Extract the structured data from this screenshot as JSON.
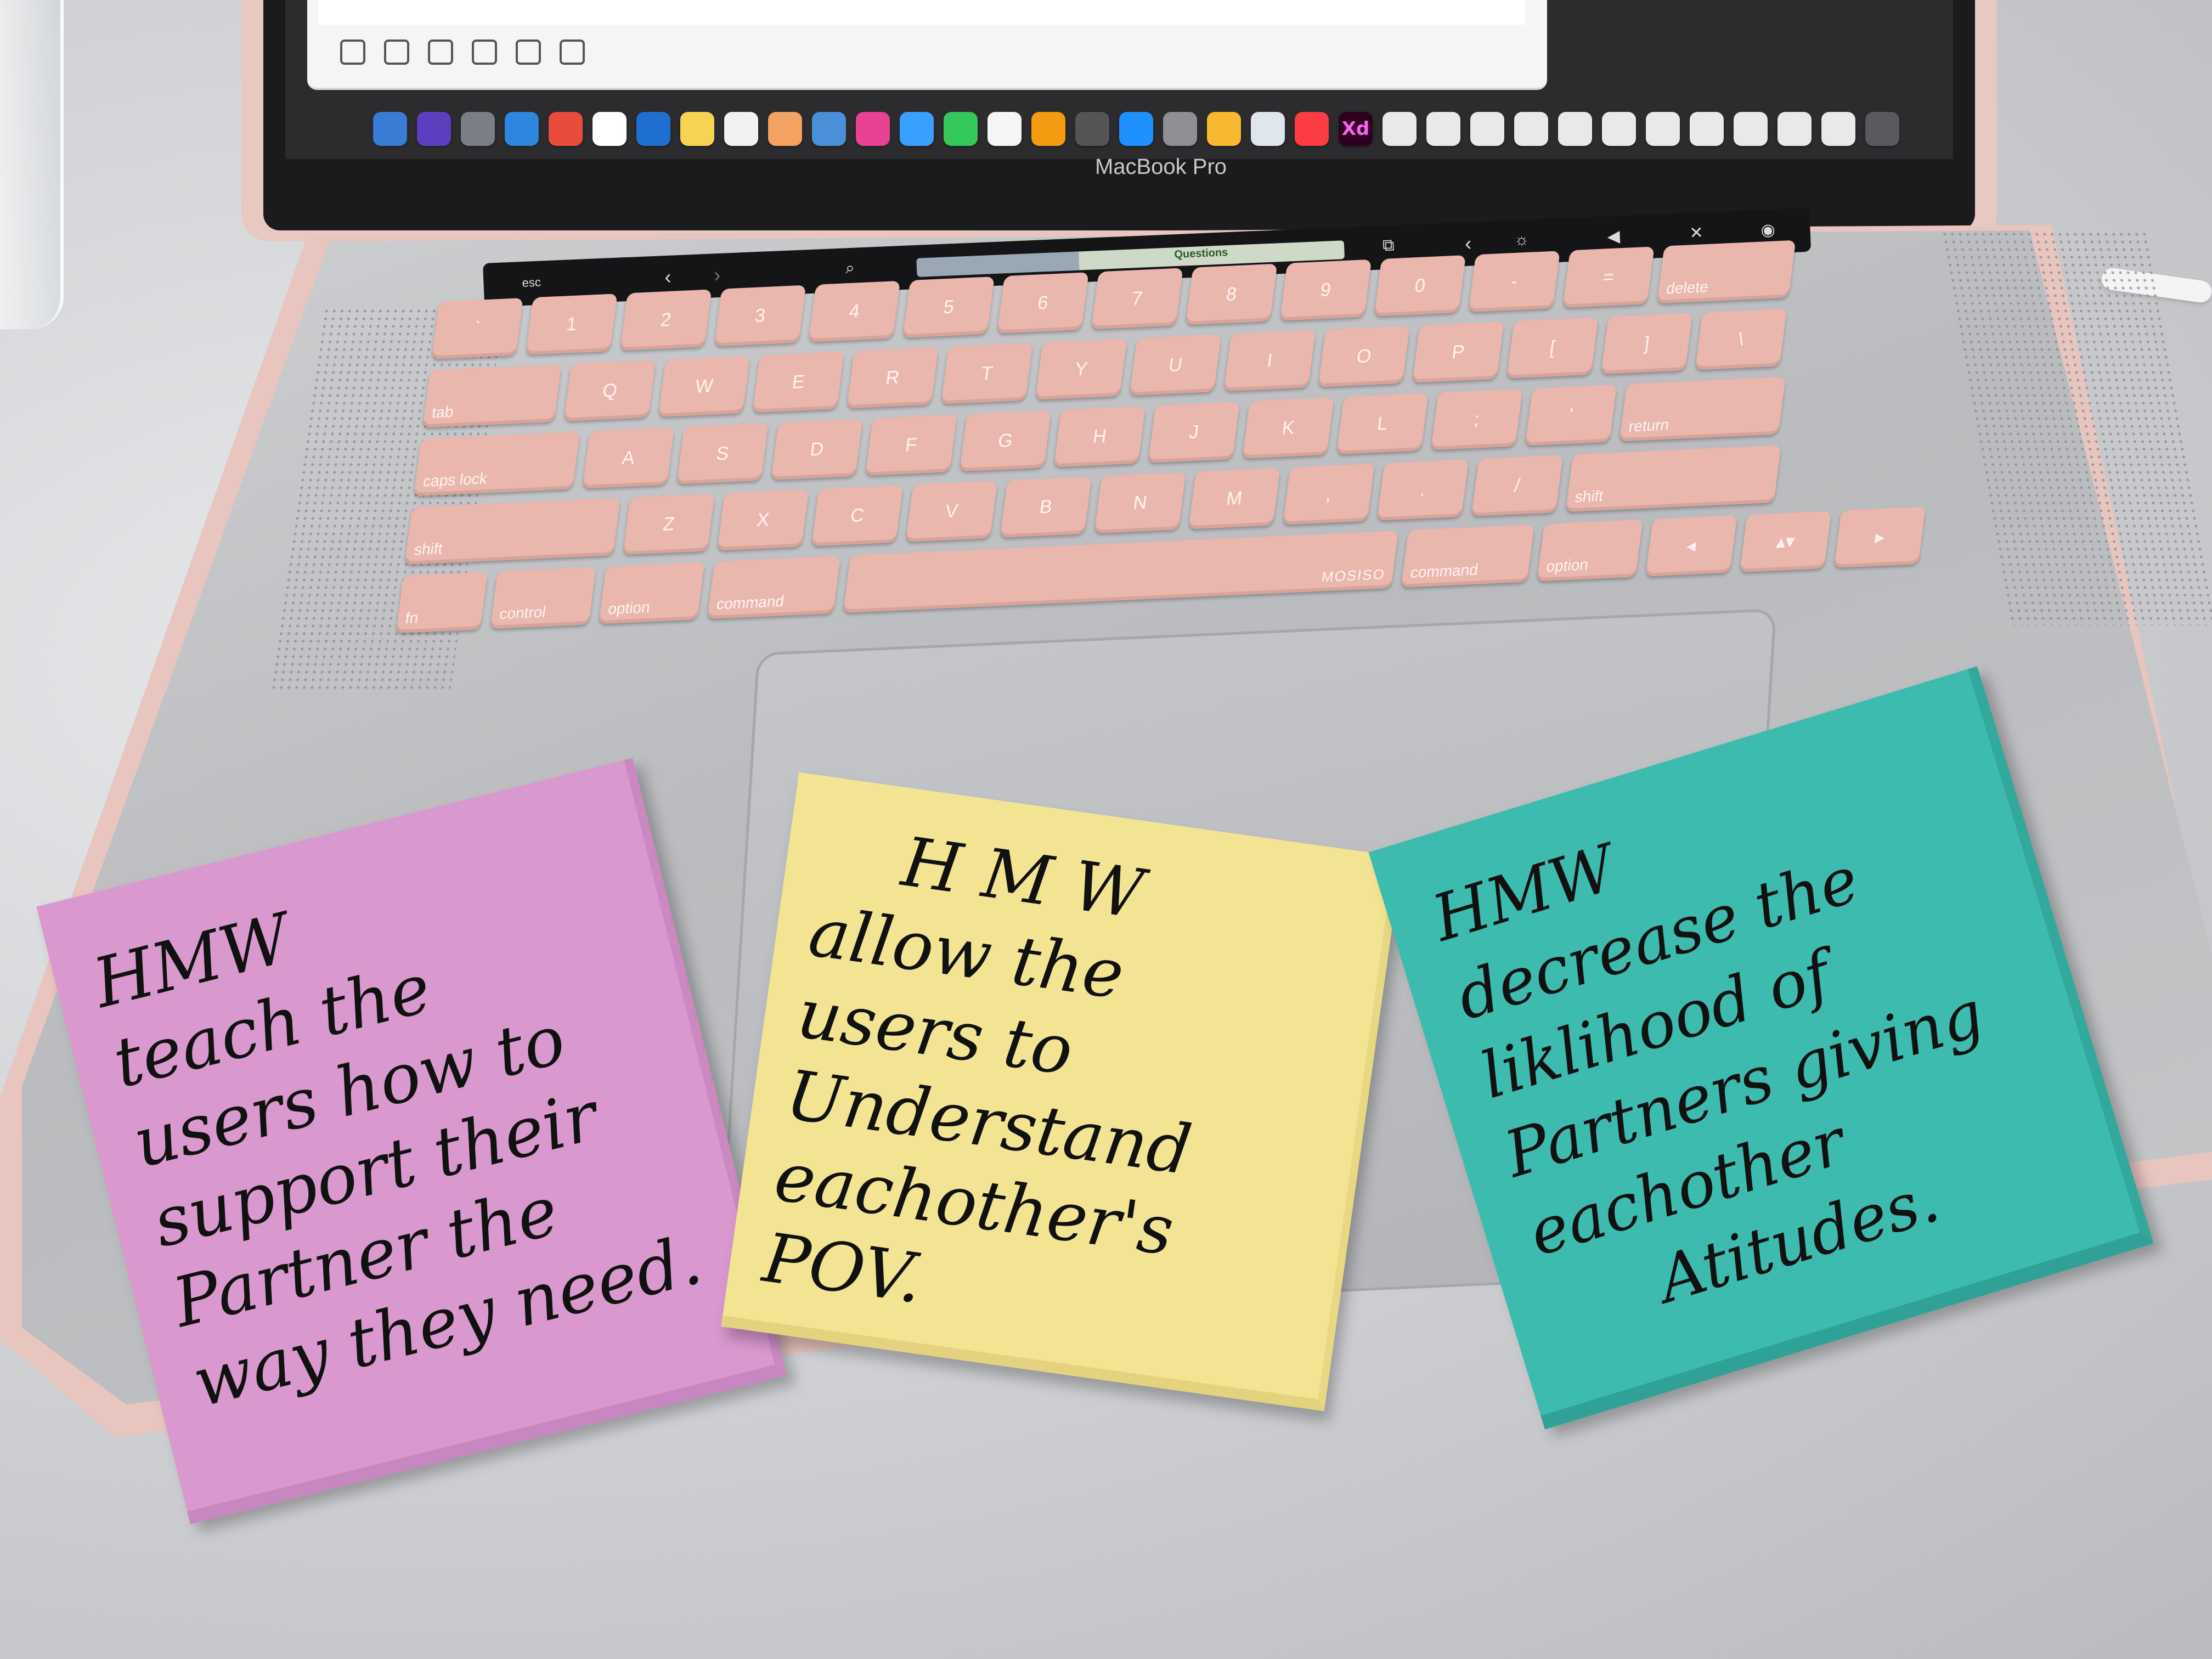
{
  "screen": {
    "brand_label": "MacBook Pro",
    "dock_xd_label": "Xd",
    "touch_bar": {
      "esc_label": "esc",
      "progress_label": "Questions"
    }
  },
  "keyboard": {
    "number_row": [
      "`",
      "1",
      "2",
      "3",
      "4",
      "5",
      "6",
      "7",
      "8",
      "9",
      "0",
      "-",
      "=",
      "delete"
    ],
    "top_row": [
      "tab",
      "Q",
      "W",
      "E",
      "R",
      "T",
      "Y",
      "U",
      "I",
      "O",
      "P",
      "[",
      "]",
      "\\"
    ],
    "home_row": [
      "caps lock",
      "A",
      "S",
      "D",
      "F",
      "G",
      "H",
      "J",
      "K",
      "L",
      ";",
      "'",
      "return"
    ],
    "bottom_row": [
      "shift",
      "Z",
      "X",
      "C",
      "V",
      "B",
      "N",
      "M",
      ",",
      ".",
      "/",
      "shift"
    ],
    "modifier_row": [
      "fn",
      "control",
      "option",
      "command",
      "MOSISO",
      "command",
      "option"
    ]
  },
  "sticky_notes": [
    {
      "color": "#d999cf",
      "lines": [
        "HMW",
        "teach the",
        "users how to",
        "support their",
        "Partner the",
        "way they need."
      ]
    },
    {
      "color": "#f3e494",
      "lines": [
        "H M W",
        "allow the",
        "users to",
        "Understand",
        "eachother's",
        "POV."
      ]
    },
    {
      "color": "#3dbbae",
      "lines": [
        "HMW",
        "decrease the",
        "liklihood of",
        "Partners giving",
        "eachother",
        "Atitudes."
      ]
    }
  ]
}
